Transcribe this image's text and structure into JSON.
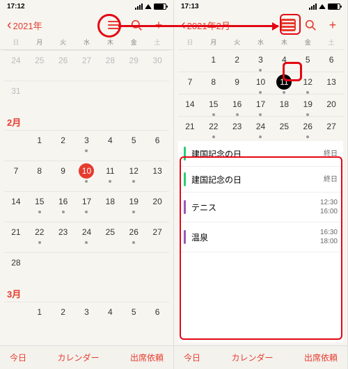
{
  "left": {
    "time": "17:12",
    "back": "2021年",
    "dow": [
      "日",
      "月",
      "火",
      "水",
      "木",
      "金",
      "土"
    ],
    "jan_end": [
      "24",
      "25",
      "26",
      "27",
      "28",
      "29",
      "30",
      "31"
    ],
    "feb_label": "2月",
    "feb": [
      [
        "",
        "1",
        "2",
        "3",
        "4",
        "5",
        "6"
      ],
      [
        "7",
        "8",
        "9",
        "10",
        "11",
        "12",
        "13"
      ],
      [
        "14",
        "15",
        "16",
        "17",
        "18",
        "19",
        "20"
      ],
      [
        "21",
        "22",
        "23",
        "24",
        "25",
        "26",
        "27"
      ],
      [
        "28",
        "",
        "",
        "",
        "",
        "",
        ""
      ]
    ],
    "mar_label": "3月",
    "mar_first": [
      "",
      "1",
      "2",
      "3",
      "4",
      "5",
      "6"
    ],
    "today": "10",
    "toolbar": {
      "today": "今日",
      "calendars": "カレンダー",
      "invites": "出席依頼"
    }
  },
  "right": {
    "time": "17:13",
    "back": "2021年2月",
    "dow": [
      "日",
      "月",
      "火",
      "水",
      "木",
      "金",
      "土"
    ],
    "feb": [
      [
        "",
        "1",
        "2",
        "3",
        "4",
        "5",
        "6"
      ],
      [
        "7",
        "8",
        "9",
        "10",
        "11",
        "12",
        "13"
      ],
      [
        "14",
        "15",
        "16",
        "17",
        "18",
        "19",
        "20"
      ],
      [
        "21",
        "22",
        "23",
        "24",
        "25",
        "26",
        "27"
      ]
    ],
    "selected": "11",
    "events": [
      {
        "title": "建国記念の日",
        "color": "#2ecc71",
        "time1": "終日",
        "time2": ""
      },
      {
        "title": "建国記念の日",
        "color": "#2ecc71",
        "time1": "終日",
        "time2": ""
      },
      {
        "title": "テニス",
        "color": "#9b59b6",
        "time1": "12:30",
        "time2": "16:00"
      },
      {
        "title": "温泉",
        "color": "#9b59b6",
        "time1": "16:30",
        "time2": "18:00"
      }
    ],
    "toolbar": {
      "today": "今日",
      "calendars": "カレンダー",
      "invites": "出席依頼"
    }
  }
}
